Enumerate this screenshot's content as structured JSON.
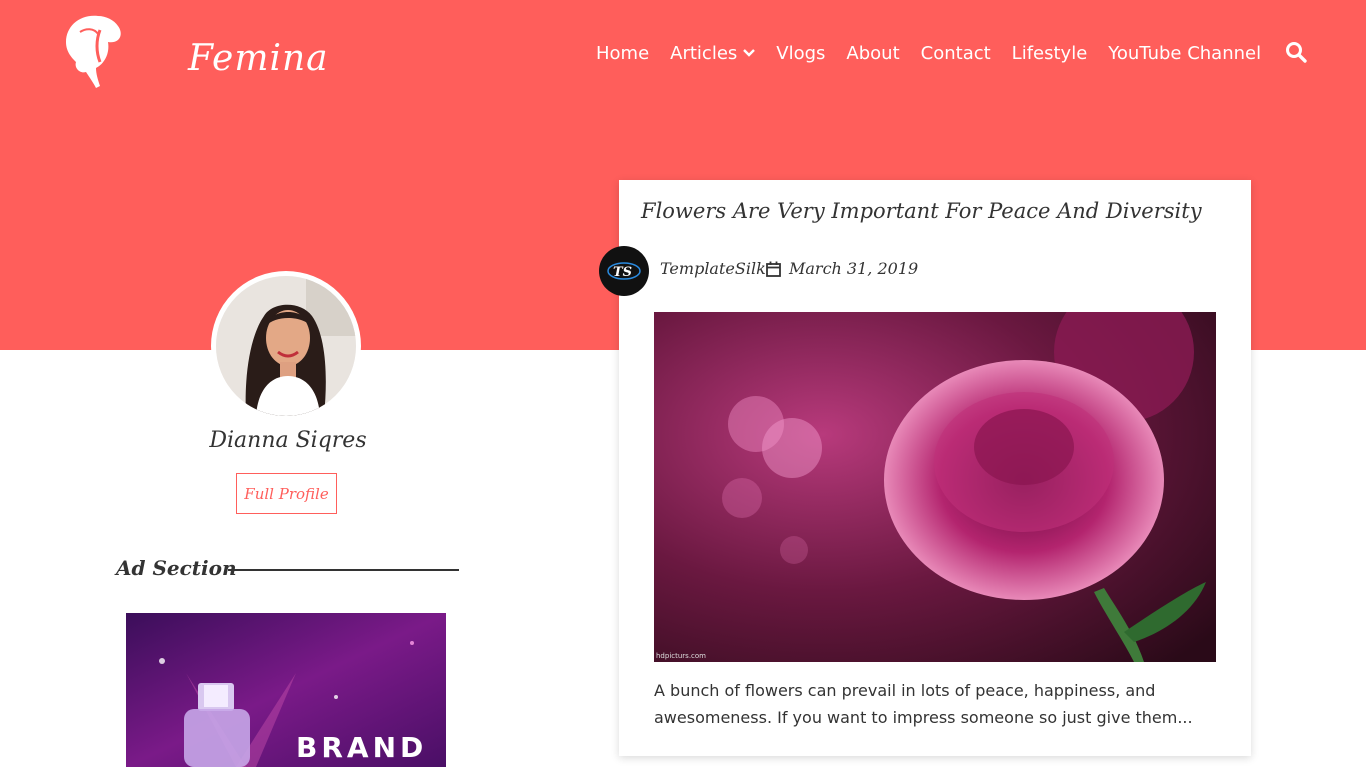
{
  "header": {
    "logo_text": "Femina",
    "nav": [
      {
        "label": "Home"
      },
      {
        "label": "Articles"
      },
      {
        "label": "Vlogs"
      },
      {
        "label": "About"
      },
      {
        "label": "Contact"
      },
      {
        "label": "Lifestyle"
      },
      {
        "label": "YouTube Channel"
      }
    ],
    "search_icon": "search-icon"
  },
  "profile": {
    "name": "Dianna Siqres",
    "button_label": "Full Profile"
  },
  "ad_section": {
    "title": "Ad Section",
    "image_text": "BRAND"
  },
  "post": {
    "title": "Flowers Are Very Important For Peace And Diversity",
    "author_badge": "TS",
    "author": "TemplateSilk",
    "date": "March 31, 2019",
    "image_credit": "hdpicturs.com",
    "excerpt": "A bunch of flowers can prevail in lots of peace, happiness, and awesomeness. If you want to impress someone so just give them..."
  },
  "colors": {
    "accent": "#ff5e5b",
    "text": "#333333",
    "white": "#ffffff"
  }
}
